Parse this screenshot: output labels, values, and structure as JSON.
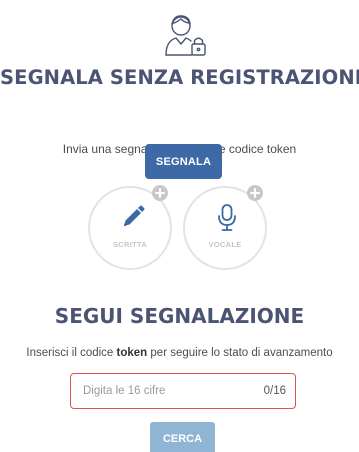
{
  "header": {
    "icon": "user-lock-icon",
    "title": "SEGNALA SENZA REGISTRAZIONE",
    "subtitle": "Invia una segnalazione tramite codice token",
    "primary_button": "SEGNALA"
  },
  "options": [
    {
      "label": "SCRITTA",
      "icon": "pencil-icon",
      "badge_icon": "plus-icon"
    },
    {
      "label": "VOCALE",
      "icon": "microphone-icon",
      "badge_icon": "plus-icon"
    }
  ],
  "follow": {
    "title": "SEGUI SEGNALAZIONE",
    "desc_before": "Inserisci il codice ",
    "desc_bold": "token",
    "desc_after": " per seguire lo stato di avanzamento",
    "input_placeholder": "Digita le 16 cifre",
    "input_value": "",
    "counter": "0/16",
    "button": "CERCA"
  },
  "colors": {
    "title": "#4b5573",
    "primary_button": "#3d6aa6",
    "search_button": "#8fb4d4",
    "input_border_error": "#d9534f",
    "option_border": "#e3e3e3"
  }
}
